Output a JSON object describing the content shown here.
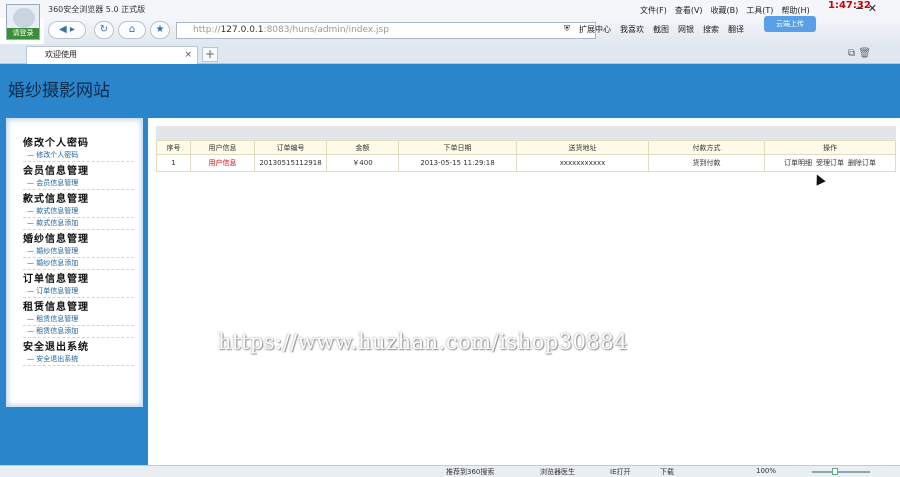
{
  "browser": {
    "app_name": "360安全浏览器 5.0 正式版",
    "login_label": "请登录",
    "menus": [
      "文件(F)",
      "查看(V)",
      "收藏(B)",
      "工具(T)",
      "帮助(H)"
    ],
    "clock": "1:47:32",
    "address": {
      "prefix": "http://",
      "host": "127.0.0.1",
      "rest": ":8083/huns/admin/index.jsp"
    },
    "toolbar": [
      "扩展中心",
      "我喜欢",
      "截图",
      "网银",
      "搜索",
      "翻译"
    ],
    "cloud_upload": "云端上传",
    "tab_title": "欢迎使用",
    "tab_close": "×",
    "new_tab": "+"
  },
  "site": {
    "title": "婚纱摄影网站"
  },
  "sidebar": {
    "groups": [
      {
        "title": "修改个人密码",
        "items": [
          "修改个人密码"
        ]
      },
      {
        "title": "会员信息管理",
        "items": [
          "会员信息管理"
        ]
      },
      {
        "title": "款式信息管理",
        "items": [
          "款式信息管理",
          "款式信息添加"
        ]
      },
      {
        "title": "婚纱信息管理",
        "items": [
          "婚纱信息管理",
          "婚纱信息添加"
        ]
      },
      {
        "title": "订单信息管理",
        "items": [
          "订单信息管理"
        ]
      },
      {
        "title": "租赁信息管理",
        "items": [
          "租赁信息管理",
          "租赁信息添加"
        ]
      },
      {
        "title": "安全退出系统",
        "items": [
          "安全退出系统"
        ]
      }
    ]
  },
  "table": {
    "headers": [
      "序号",
      "用户信息",
      "订单编号",
      "金额",
      "下单日期",
      "送货地址",
      "付款方式",
      "操作"
    ],
    "rows": [
      {
        "index": "1",
        "user": "用户信息",
        "order_no": "20130515112918",
        "amount": "￥400",
        "date": "2013-05-15 11:29:18",
        "address": "xxxxxxxxxxx",
        "payment": "货到付款",
        "ops": [
          "订单明细",
          "受理订单",
          "删除订单"
        ]
      }
    ]
  },
  "watermark": "https://www.huzhan.com/ishop30884",
  "statusbar": {
    "items": [
      "推荐到360搜索",
      "浏览器医生",
      "IE打开",
      "下载",
      "100%"
    ]
  },
  "colors": {
    "page_bg": "#2b85cb",
    "user_link": "#dd0000"
  }
}
